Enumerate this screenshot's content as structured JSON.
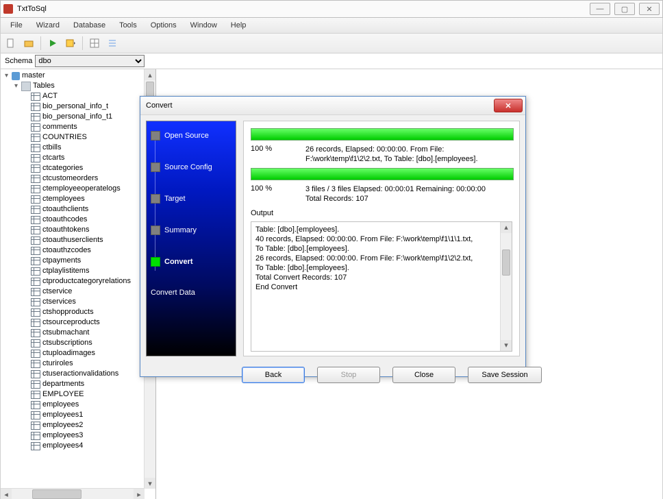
{
  "app": {
    "title": "TxtToSql"
  },
  "window_controls": {
    "min": "—",
    "max": "▢",
    "close": "✕"
  },
  "menu": [
    "File",
    "Wizard",
    "Database",
    "Tools",
    "Options",
    "Window",
    "Help"
  ],
  "schema": {
    "label": "Schema",
    "value": "dbo"
  },
  "tree": {
    "root": "master",
    "folder": "Tables",
    "items": [
      "ACT",
      "bio_personal_info_t",
      "bio_personal_info_t1",
      "comments",
      "COUNTRIES",
      "ctbills",
      "ctcarts",
      "ctcategories",
      "ctcustomeorders",
      "ctemployeeoperatelogs",
      "ctemployees",
      "ctoauthclients",
      "ctoauthcodes",
      "ctoauthtokens",
      "ctoauthuserclients",
      "ctoauthzcodes",
      "ctpayments",
      "ctplaylistitems",
      "ctproductcategoryrelations",
      "ctservice",
      "ctservices",
      "ctshopproducts",
      "ctsourceproducts",
      "ctsubmachant",
      "ctsubscriptions",
      "ctuploadimages",
      "cturiroles",
      "ctuseractionvalidations",
      "departments",
      "EMPLOYEE",
      "employees",
      "employees1",
      "employees2",
      "employees3",
      "employees4"
    ]
  },
  "dialog": {
    "title": "Convert",
    "steps": {
      "items": [
        "Open Source",
        "Source Config",
        "Target",
        "Summary",
        "Convert"
      ],
      "active_index": 4,
      "subtitle": "Convert Data"
    },
    "progress1": {
      "pct": "100 %",
      "line1": "26 records,   Elapsed: 00:00:00.   From File:",
      "line2": "F:\\work\\temp\\f1\\2\\2.txt,   To Table: [dbo].[employees]."
    },
    "progress2": {
      "pct": "100 %",
      "line1": "3 files / 3 files   Elapsed: 00:00:01   Remaining: 00:00:00",
      "line2": "Total Records: 107"
    },
    "output_label": "Output",
    "output_lines": [
      "Table: [dbo].[employees].",
      "40 records,   Elapsed: 00:00:00.   From File: F:\\work\\temp\\f1\\1\\1.txt,",
      "To Table: [dbo].[employees].",
      "26 records,   Elapsed: 00:00:00.   From File: F:\\work\\temp\\f1\\2\\2.txt,",
      "To Table: [dbo].[employees].",
      "Total Convert Records: 107",
      "End Convert"
    ],
    "buttons": {
      "back": "Back",
      "stop": "Stop",
      "close": "Close",
      "save": "Save Session"
    }
  }
}
